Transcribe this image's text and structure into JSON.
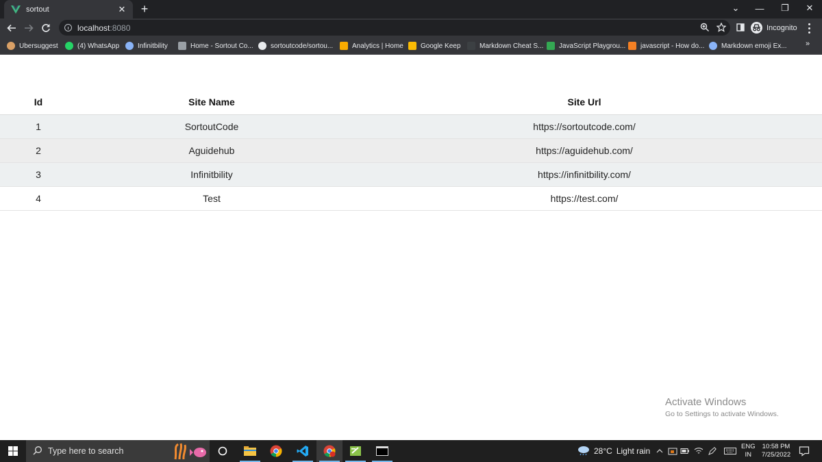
{
  "browser": {
    "tab": {
      "title": "sortout",
      "close": "✕"
    },
    "new_tab": "+",
    "window_controls": {
      "chevron": "⌄",
      "minimize": "—",
      "restore": "❐",
      "close": "✕"
    },
    "address": {
      "host": "localhost",
      "port": ":8080"
    },
    "profile": {
      "label": "Incognito"
    },
    "bookmarks": [
      {
        "label": "Ubersuggest",
        "color": "#d9a066"
      },
      {
        "label": "(4) WhatsApp",
        "color": "#25d366"
      },
      {
        "label": "Infinitbility",
        "color": "#8ab4f8"
      },
      {
        "label": "Home - Sortout Co...",
        "color": "#9aa0a6"
      },
      {
        "label": "sortoutcode/sortou...",
        "color": "#e8eaed"
      },
      {
        "label": "Analytics | Home",
        "color": "#f9ab00"
      },
      {
        "label": "Google Keep",
        "color": "#fbbc04"
      },
      {
        "label": "Markdown Cheat S...",
        "color": "#3c4043"
      },
      {
        "label": "JavaScript Playgrou...",
        "color": "#34a853"
      },
      {
        "label": "javascript - How do...",
        "color": "#f48024"
      },
      {
        "label": "Markdown emoji Ex...",
        "color": "#8ab4f8"
      }
    ],
    "bookmarks_more": "»"
  },
  "table": {
    "headers": {
      "id": "Id",
      "name": "Site Name",
      "url": "Site Url"
    },
    "rows": [
      {
        "id": "1",
        "name": "SortoutCode",
        "url": "https://sortoutcode.com/"
      },
      {
        "id": "2",
        "name": "Aguidehub",
        "url": "https://aguidehub.com/"
      },
      {
        "id": "3",
        "name": "Infinitbility",
        "url": "https://infinitbility.com/"
      },
      {
        "id": "4",
        "name": "Test",
        "url": "https://test.com/"
      }
    ]
  },
  "watermark": {
    "title": "Activate Windows",
    "subtitle": "Go to Settings to activate Windows."
  },
  "taskbar": {
    "search_placeholder": "Type here to search",
    "weather": {
      "temp": "28°C",
      "condition": "Light rain"
    },
    "language": {
      "line1": "ENG",
      "line2": "IN"
    },
    "clock": {
      "time": "10:58 PM",
      "date": "7/25/2022"
    }
  },
  "colors": {
    "chrome_dark": "#202124",
    "chrome_toolbar": "#35363a",
    "row_stripe": "#edf0f1",
    "row_gray": "#ededed",
    "taskbar": "#1f1f1f",
    "vue_green": "#41b883"
  }
}
